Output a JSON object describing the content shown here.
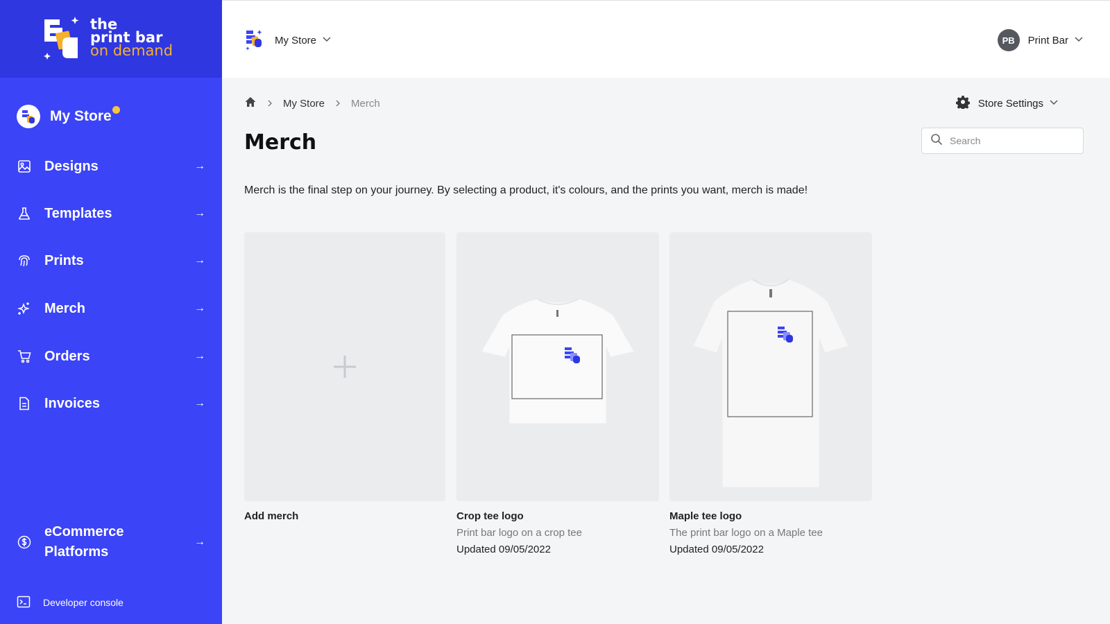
{
  "brand": {
    "line1": "the",
    "line2": "print bar",
    "line3": "on demand",
    "accent_color": "#f5b02e"
  },
  "sidebar": {
    "store_name": "My Store",
    "items": [
      {
        "label": "Designs",
        "icon": "image-icon",
        "arrow": "→"
      },
      {
        "label": "Templates",
        "icon": "flask-icon",
        "arrow": "→"
      },
      {
        "label": "Prints",
        "icon": "fingerprint-icon",
        "arrow": "→"
      },
      {
        "label": "Merch",
        "icon": "sparkle-icon",
        "arrow": "→"
      },
      {
        "label": "Orders",
        "icon": "cart-icon",
        "arrow": "→"
      },
      {
        "label": "Invoices",
        "icon": "document-icon",
        "arrow": "→"
      }
    ],
    "ecommerce_line1": "eCommerce",
    "ecommerce_line2": "Platforms",
    "ecommerce_arrow": "→",
    "developer_console": "Developer console",
    "bg_color": "#3b44f6"
  },
  "topbar": {
    "store_label": "My Store",
    "user_initials": "PB",
    "user_name": "Print Bar"
  },
  "breadcrumb": {
    "home": "home-icon",
    "items": [
      "My Store",
      "Merch"
    ]
  },
  "store_settings_label": "Store Settings",
  "page": {
    "title": "Merch",
    "description": "Merch is the final step on your journey. By selecting a product, it's colours, and the prints you want, merch is made!"
  },
  "search": {
    "placeholder": "Search",
    "value": ""
  },
  "cards": {
    "add": {
      "title": "Add merch"
    },
    "crop": {
      "title": "Crop tee logo",
      "description": "Print bar logo on a crop tee",
      "updated": "Updated 09/05/2022"
    },
    "maple": {
      "title": "Maple tee logo",
      "description": "The print bar logo on a Maple tee",
      "updated": "Updated 09/05/2022"
    }
  }
}
